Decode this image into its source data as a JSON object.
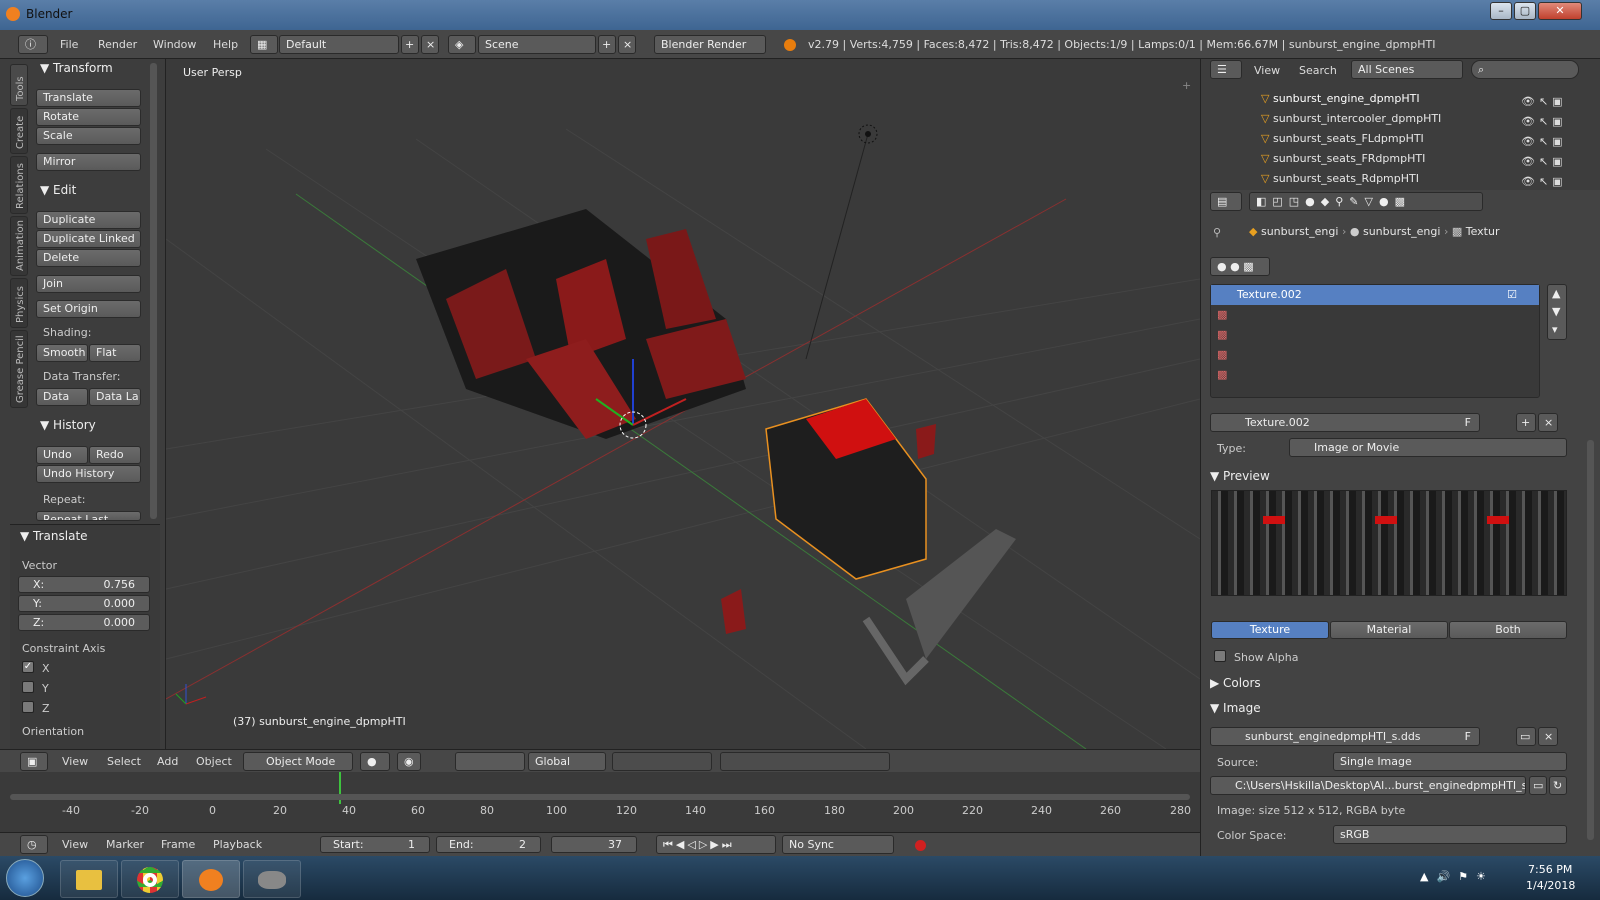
{
  "window": {
    "title": "Blender"
  },
  "info": {
    "menus": [
      "File",
      "Render",
      "Window",
      "Help"
    ],
    "layout": "Default",
    "scene": "Scene",
    "engine": "Blender Render",
    "stats": "v2.79 | Verts:4,759 | Faces:8,472 | Tris:8,472 | Objects:1/9 | Lamps:0/1 | Mem:66.67M | sunburst_engine_dpmpHTI"
  },
  "tools": {
    "tabs": [
      "Tools",
      "Create",
      "Relations",
      "Animation",
      "Physics",
      "Grease Pencil"
    ],
    "transform_title": "Transform",
    "translate": "Translate",
    "rotate": "Rotate",
    "scale": "Scale",
    "mirror": "Mirror",
    "edit_title": "Edit",
    "duplicate": "Duplicate",
    "duplicate_linked": "Duplicate Linked",
    "delete": "Delete",
    "join": "Join",
    "set_origin": "Set Origin",
    "shading_label": "Shading:",
    "smooth": "Smooth",
    "flat": "Flat",
    "data_transfer_label": "Data Transfer:",
    "data": "Data",
    "data_la": "Data La",
    "history_title": "History",
    "undo": "Undo",
    "redo": "Redo",
    "undo_history": "Undo History",
    "repeat_label": "Repeat:",
    "repeat_last": "Repeat Last"
  },
  "operator": {
    "title": "Translate",
    "vector_label": "Vector",
    "x_label": "X:",
    "x": "0.756",
    "y_label": "Y:",
    "y": "0.000",
    "z_label": "Z:",
    "z": "0.000",
    "constraint_label": "Constraint Axis",
    "cx": "X",
    "cy": "Y",
    "cz": "Z",
    "orientation": "Orientation"
  },
  "viewport": {
    "persp": "User Persp",
    "object_label": "(37) sunburst_engine_dpmpHTI",
    "header": {
      "view": "View",
      "select": "Select",
      "add": "Add",
      "object": "Object",
      "mode": "Object Mode",
      "orientation": "Global"
    }
  },
  "timeline": {
    "view": "View",
    "marker": "Marker",
    "frame": "Frame",
    "playback": "Playback",
    "start_label": "Start:",
    "start": "1",
    "end_label": "End:",
    "end": "2",
    "current": "37",
    "sync": "No Sync",
    "ticks": [
      "-40",
      "-20",
      "0",
      "20",
      "40",
      "60",
      "80",
      "100",
      "120",
      "140",
      "160",
      "180",
      "200",
      "220",
      "240",
      "260",
      "280"
    ]
  },
  "outliner": {
    "view": "View",
    "search": "Search",
    "filter": "All Scenes",
    "items": [
      "sunburst_engine_dpmpHTI",
      "sunburst_intercooler_dpmpHTI",
      "sunburst_seats_FLdpmpHTI",
      "sunburst_seats_FRdpmpHTI",
      "sunburst_seats_RdpmpHTI"
    ]
  },
  "properties": {
    "breadcrumb": [
      "sunburst_engi",
      "sunburst_engi",
      "Textur"
    ],
    "slot_selected": "Texture.002",
    "texture_name": "Texture.002",
    "fake_user": "F",
    "type_label": "Type:",
    "type_value": "Image or Movie",
    "preview_title": "Preview",
    "preview_tabs": [
      "Texture",
      "Material",
      "Both"
    ],
    "show_alpha": "Show Alpha",
    "colors_title": "Colors",
    "image_title": "Image",
    "image_name": "sunburst_enginedpmpHTI_s.dds",
    "source_label": "Source:",
    "source_value": "Single Image",
    "filepath": "C:\\Users\\Hskilla\\Desktop\\Al...burst_enginedpmpHTI_s.dds",
    "image_info": "Image: size 512 x 512, RGBA byte",
    "colorspace_label": "Color Space:",
    "colorspace_value": "sRGB"
  },
  "taskbar": {
    "time": "7:56 PM",
    "date": "1/4/2018"
  },
  "colors": {
    "accent": "#5680c2",
    "seat_red": "#8a1a1a",
    "engine_red": "#d01010"
  }
}
